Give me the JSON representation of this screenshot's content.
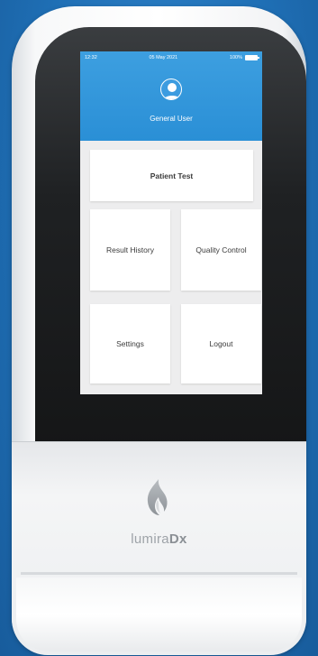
{
  "status_bar": {
    "time": "12:32",
    "date": "05 May 2021",
    "battery": "100%"
  },
  "user": {
    "label": "General User"
  },
  "menu": {
    "patient_test": "Patient Test",
    "result_history": "Result History",
    "quality_control": "Quality Control",
    "settings": "Settings",
    "logout": "Logout"
  },
  "brand": {
    "name_light": "lumira",
    "name_bold": "Dx"
  },
  "colors": {
    "background": "#1f6fb5",
    "header": "#2a8fd6",
    "tile": "#ffffff",
    "screen_bg": "#ededee"
  },
  "icons": [
    "user-avatar-icon",
    "battery-icon",
    "lumiradx-flame-logo"
  ]
}
